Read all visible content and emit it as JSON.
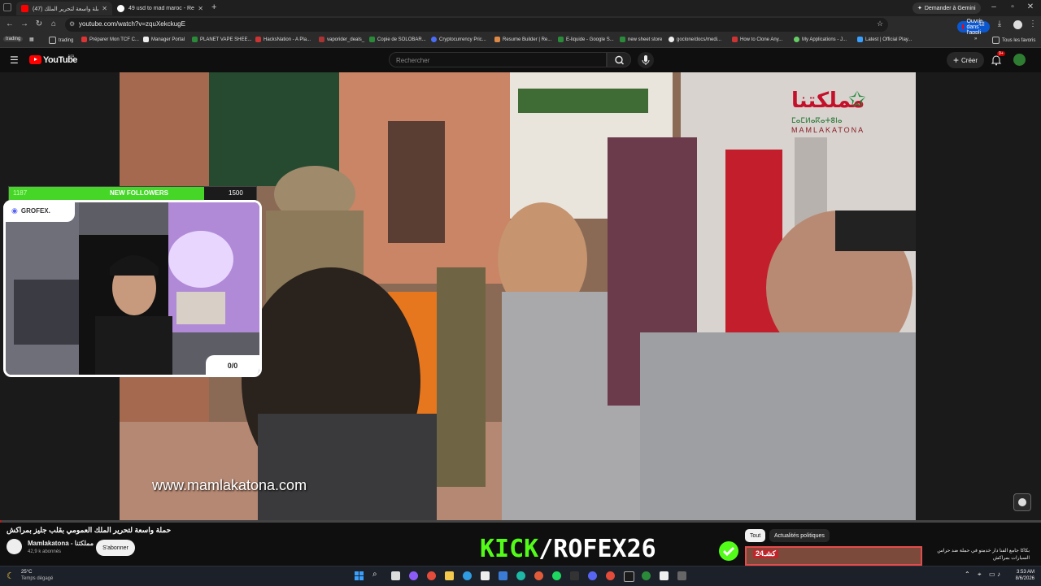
{
  "browser": {
    "tabs": [
      {
        "label": "(47) حملة واسعة لتحرير الملك...",
        "active": true
      },
      {
        "label": "49 usd to mad maroc - Recherche",
        "active": false
      }
    ],
    "new_tab": "+",
    "url": "youtube.com/watch?v=zquXekckugE",
    "open_app": "Ouvrir dans l'appli",
    "gemini": "Demander à Gemini",
    "bookmarks": [
      "trading",
      "Préparer Mon TCF C...",
      "Manager Portal",
      "PLANET VAPE SHEE...",
      "HacksNation - A Pla...",
      "vaporider_deals_",
      "Copie de SOLOBAR...",
      "Cryptocurrency Pric...",
      "Resume Builder | Re...",
      "E-liquide - Google S...",
      "new sheet store",
      "goclone/docs/medi...",
      "How to Clone Any...",
      "My Applications - J...",
      "Latest | Official Play..."
    ],
    "all_bookmarks": "Tous les favoris"
  },
  "youtube": {
    "wordmark": "YouTube",
    "country": "MA",
    "search_placeholder": "Rechercher",
    "create": "Créer",
    "notif_count": "9+"
  },
  "overlay": {
    "followers_current": "1187",
    "followers_label": "NEW FOLLOWERS",
    "followers_goal": "1500",
    "followers_progress": 0.79,
    "streamer": "GROFEX.",
    "score": "0/0"
  },
  "video": {
    "watermark": "www.mamlakatona.com",
    "logo_arabic": "مملكتنا",
    "logo_tifinagh": "ⵎⴰⵎⵍⴰⴽⴰⵜⵓⵏⴰ",
    "logo_latin": "MAMLAKATONA",
    "title": "حملة واسعة لتحرير الملك العمومي بقلب جليز بمراكش",
    "channel_name": "Mamlakatona - مملكتنا",
    "subscribers": "42,9 k abonnés",
    "subscribe": "S'abonner"
  },
  "branding": {
    "kick_part1": "KICK",
    "kick_part2": "/ROFEX26"
  },
  "chips": [
    {
      "label": "Tout",
      "active": true
    },
    {
      "label": "Actualités politiques",
      "active": false
    }
  ],
  "related": {
    "title": "بكاكا جامع الفنا دار خدمتو في حملة ضد حراس السيارات بمراكش",
    "thumb_logo": "كشـ24"
  },
  "taskbar": {
    "weather_temp": "25°C",
    "weather_desc": "Temps dégagé",
    "time": "3:53 AM",
    "date": "8/6/2026"
  },
  "colors": {
    "kick_green": "#53fc18",
    "yt_red": "#ff0000",
    "subscribe_bg": "#f1f1f1"
  }
}
